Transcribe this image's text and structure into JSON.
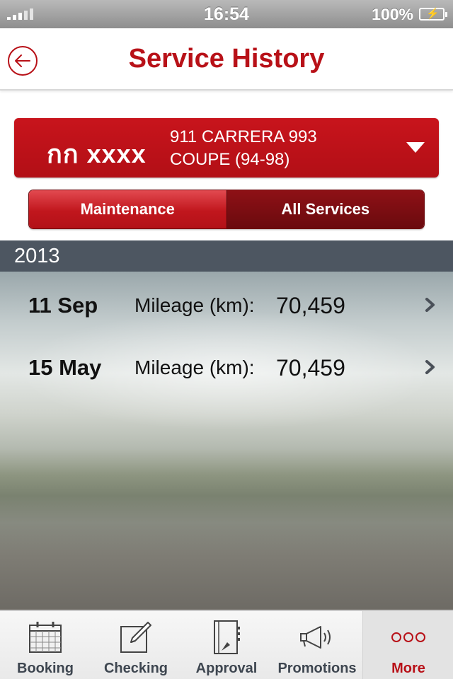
{
  "status_bar": {
    "time": "16:54",
    "battery": "100%"
  },
  "nav": {
    "title": "Service History",
    "back_icon": "back-arrow-icon"
  },
  "vehicle": {
    "plate": "กก xxxx",
    "model_line1": "911 CARRERA 993",
    "model_line2": "COUPE (94-98)"
  },
  "segments": [
    {
      "label": "Maintenance",
      "active": true
    },
    {
      "label": "All Services",
      "active": false
    }
  ],
  "year": "2013",
  "services": [
    {
      "date": "11 Sep",
      "mileage_label": "Mileage (km):",
      "mileage_value": "70,459"
    },
    {
      "date": "15 May",
      "mileage_label": "Mileage (km):",
      "mileage_value": "70,459"
    }
  ],
  "tabs": [
    {
      "label": "Booking",
      "icon": "calendar-icon"
    },
    {
      "label": "Checking",
      "icon": "edit-icon"
    },
    {
      "label": "Approval",
      "icon": "document-icon"
    },
    {
      "label": "Promotions",
      "icon": "megaphone-icon"
    },
    {
      "label": "More",
      "icon": "more-icon",
      "selected": true
    }
  ],
  "colors": {
    "accent": "#b81118",
    "year_header": "#4d5661",
    "tab_text": "#3e4650"
  }
}
